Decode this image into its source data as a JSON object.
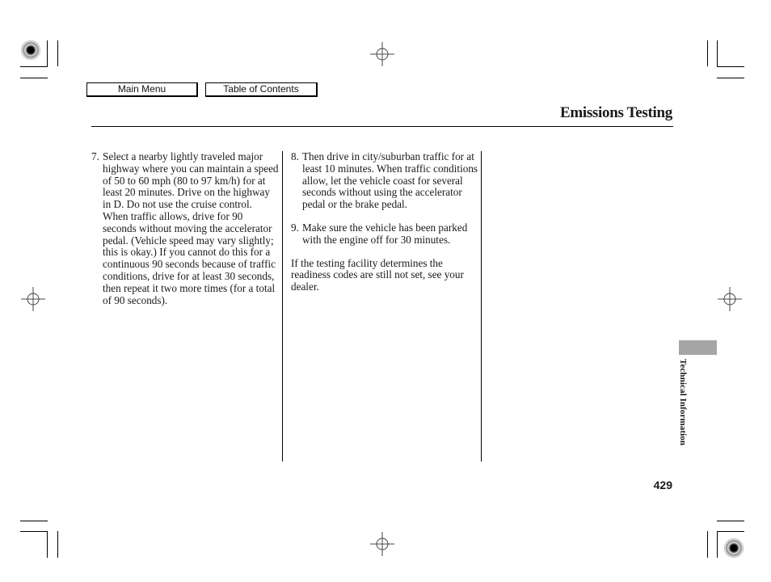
{
  "nav": {
    "main_menu": "Main Menu",
    "table_of_contents": "Table of Contents"
  },
  "page": {
    "title": "Emissions Testing",
    "section_tab": "Technical Information",
    "page_number": "429",
    "tab_color": "#a6a6a6"
  },
  "content": {
    "col1": [
      {
        "number": "7.",
        "text": "Select a nearby lightly traveled major highway where you can maintain a speed of 50 to 60 mph (80 to 97 km/h) for at least 20 minutes. Drive on the highway in D. Do not use the cruise control. When traffic allows, drive for 90 seconds without moving the accelerator pedal. (Vehicle speed may vary slightly; this is okay.) If you cannot do this for a continuous 90 seconds because of traffic conditions, drive for at least 30 seconds, then repeat it two more times (for a total of 90 seconds)."
      }
    ],
    "col2": [
      {
        "number": "8.",
        "text": "Then drive in city/suburban traffic for at least 10 minutes. When traffic conditions allow, let the vehicle coast for several seconds without using the accelerator pedal or the brake pedal."
      },
      {
        "number": "9.",
        "text": "Make sure the vehicle has been parked with the engine off for 30 minutes."
      }
    ],
    "note": "If the testing facility determines the readiness codes are still not set, see your dealer."
  }
}
